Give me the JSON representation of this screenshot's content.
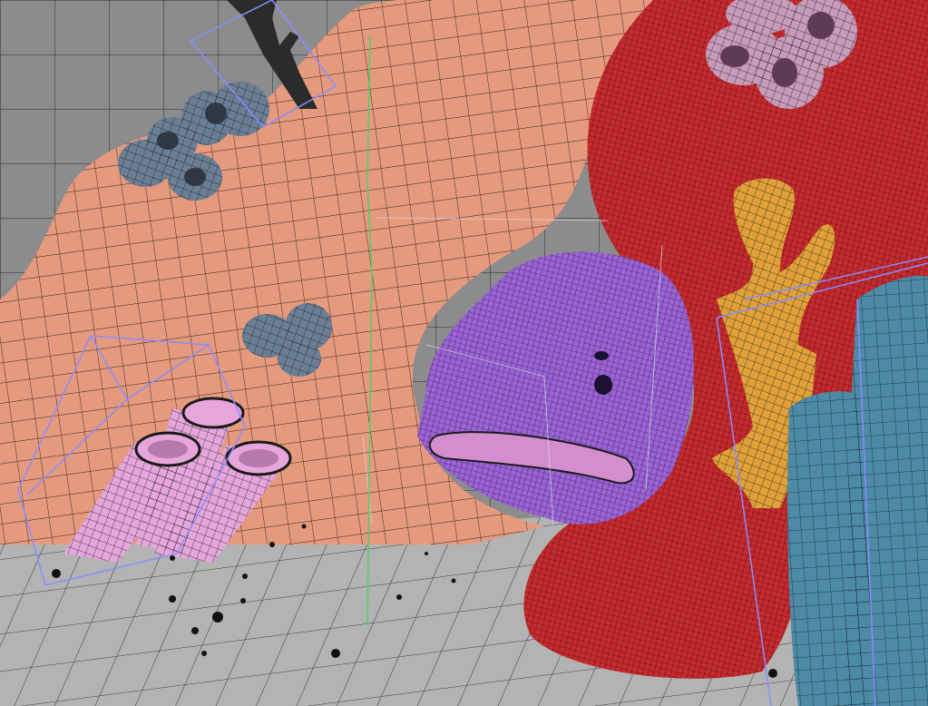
{
  "colors": {
    "viewport_bg": "#8c8c8c",
    "grid_floor": "#b3b3b3",
    "grid_line": "#3a3a3a",
    "rock_salmon": "#e59a7e",
    "coral_red": "#c62a2e",
    "fish_purple": "#9a63d8",
    "tube_pink": "#e6a6dc",
    "tube_mauve": "#c79bb9",
    "tube_slate": "#6a7f95",
    "branch_orange": "#e0a238",
    "branch_dark": "#2b2b2b",
    "pillar_teal": "#4d8aa6",
    "selection_bbox": "#8a8cff",
    "axis_green": "#4fd06a",
    "wire_line": "#1a1a1a"
  },
  "icons": {
    "viewport": "3d-viewport-icon"
  }
}
